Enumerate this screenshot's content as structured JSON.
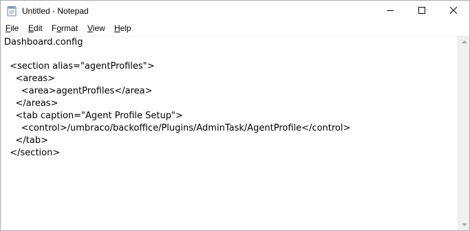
{
  "window": {
    "title": "Untitled - Notepad",
    "app_icon": "notepad-icon"
  },
  "controls": {
    "minimize_icon": "minimize-icon",
    "maximize_icon": "maximize-icon",
    "close_icon": "close-icon"
  },
  "menu": {
    "file": {
      "mnemonic": "F",
      "rest": "ile"
    },
    "edit": {
      "mnemonic": "E",
      "rest": "dit"
    },
    "format": {
      "before": "F",
      "mnemonic": "o",
      "rest": "rmat"
    },
    "view": {
      "mnemonic": "V",
      "rest": "iew"
    },
    "help": {
      "mnemonic": "H",
      "rest": "elp"
    }
  },
  "editor": {
    "lines": [
      "Dashboard.config",
      "",
      "  <section alias=\"agentProfiles\">",
      "    <areas>",
      "      <area>agentProfiles</area>",
      "    </areas>",
      "    <tab caption=\"Agent Profile Setup\">",
      "      <control>/umbraco/backoffice/Plugins/AdminTask/AgentProfile</control>",
      "    </tab>",
      "  </section>"
    ]
  },
  "colors": {
    "text": "#000000",
    "scrollbar_track": "#f0f0f0",
    "scroll_arrow": "#a3a3a3",
    "window_border": "#aaaaaa"
  }
}
